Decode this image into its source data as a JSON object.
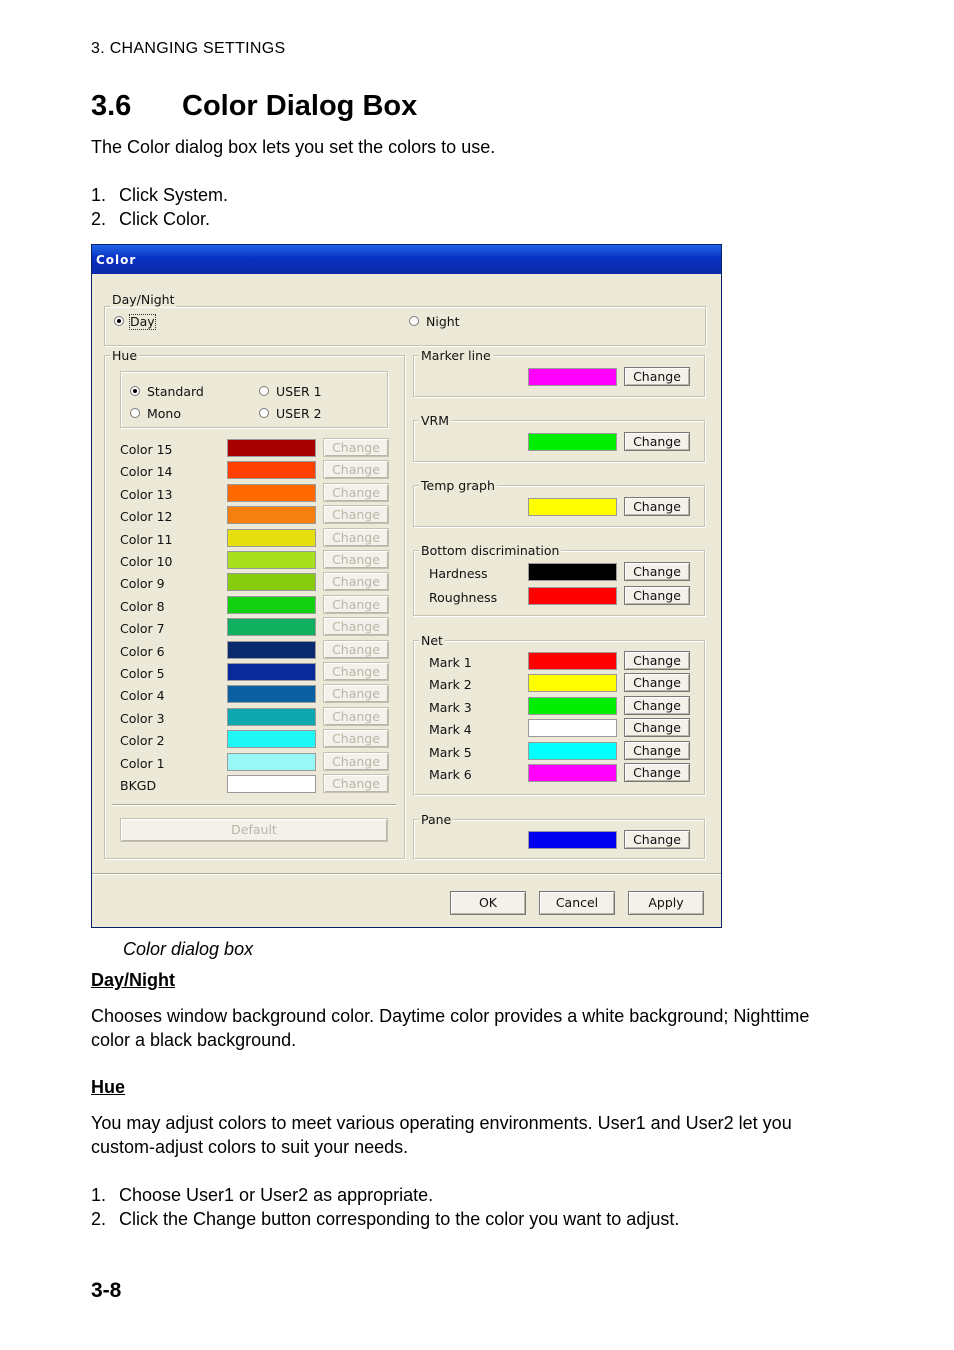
{
  "page": {
    "header": "3. CHANGING  SETTINGS",
    "section_number": "3.6",
    "section_title": "Color Dialog Box",
    "intro": "The Color dialog box lets you set the colors to use.",
    "steps_top": [
      {
        "num": "1.",
        "text": "Click System."
      },
      {
        "num": "2.",
        "text": "Click Color."
      }
    ],
    "caption": "Color dialog box",
    "daynight_heading": "Day/Night",
    "daynight_text_1": "Chooses window background color. Daytime color provides a white background; Nighttime",
    "daynight_text_2": "color a black background.",
    "hue_heading": "Hue",
    "hue_text_1": "You may adjust colors to meet various operating environments. User1 and User2 let you",
    "hue_text_2": "custom-adjust colors to suit your needs.",
    "steps_bottom": [
      {
        "num": "1.",
        "text": "Choose User1 or User2 as appropriate."
      },
      {
        "num": "2.",
        "text": "Click the Change button corresponding to the color you want to adjust."
      }
    ],
    "page_number": "3-8"
  },
  "dialog": {
    "title": "Color",
    "daynight": {
      "label": "Day/Night",
      "options": [
        {
          "label": "Day",
          "selected": true
        },
        {
          "label": "Night",
          "selected": false
        }
      ]
    },
    "hue": {
      "label": "Hue",
      "options": [
        {
          "label": "Standard",
          "selected": true
        },
        {
          "label": "USER 1",
          "selected": false
        },
        {
          "label": "Mono",
          "selected": false
        },
        {
          "label": "USER 2",
          "selected": false
        }
      ],
      "colors": [
        {
          "label": "Color 15",
          "color": "#a80000"
        },
        {
          "label": "Color 14",
          "color": "#ff4000"
        },
        {
          "label": "Color 13",
          "color": "#ff6a00"
        },
        {
          "label": "Color 12",
          "color": "#f58010"
        },
        {
          "label": "Color 11",
          "color": "#e6e010"
        },
        {
          "label": "Color 10",
          "color": "#a8e020"
        },
        {
          "label": "Color 9",
          "color": "#88cc10"
        },
        {
          "label": "Color 8",
          "color": "#10d010"
        },
        {
          "label": "Color 7",
          "color": "#10b060"
        },
        {
          "label": "Color 6",
          "color": "#0a2a70"
        },
        {
          "label": "Color 5",
          "color": "#0a2a9a"
        },
        {
          "label": "Color 4",
          "color": "#0a60a0"
        },
        {
          "label": "Color 3",
          "color": "#10a8b0"
        },
        {
          "label": "Color 2",
          "color": "#20f8f8"
        },
        {
          "label": "Color 1",
          "color": "#98f8f8"
        },
        {
          "label": "BKGD",
          "color": "#ffffff"
        }
      ],
      "change_label": "Change",
      "default_label": "Default"
    },
    "marker_line": {
      "label": "Marker line",
      "color": "#ff00ff",
      "change_label": "Change"
    },
    "vrm": {
      "label": "VRM",
      "color": "#00ee00",
      "change_label": "Change"
    },
    "temp_graph": {
      "label": "Temp graph",
      "color": "#ffff00",
      "change_label": "Change"
    },
    "bottom_discrimination": {
      "label": "Bottom discrimination",
      "items": [
        {
          "label": "Hardness",
          "color": "#000000",
          "change_label": "Change"
        },
        {
          "label": "Roughness",
          "color": "#ff0000",
          "change_label": "Change"
        }
      ]
    },
    "net": {
      "label": "Net",
      "items": [
        {
          "label": "Mark 1",
          "color": "#ff0000",
          "change_label": "Change"
        },
        {
          "label": "Mark 2",
          "color": "#ffff00",
          "change_label": "Change"
        },
        {
          "label": "Mark 3",
          "color": "#00ee00",
          "change_label": "Change"
        },
        {
          "label": "Mark 4",
          "color": "#ffffff",
          "change_label": "Change"
        },
        {
          "label": "Mark 5",
          "color": "#00ffff",
          "change_label": "Change"
        },
        {
          "label": "Mark 6",
          "color": "#ff00ff",
          "change_label": "Change"
        }
      ]
    },
    "pane": {
      "label": "Pane",
      "color": "#0000ee",
      "change_label": "Change"
    },
    "buttons": {
      "ok": "OK",
      "cancel": "Cancel",
      "apply": "Apply"
    }
  }
}
